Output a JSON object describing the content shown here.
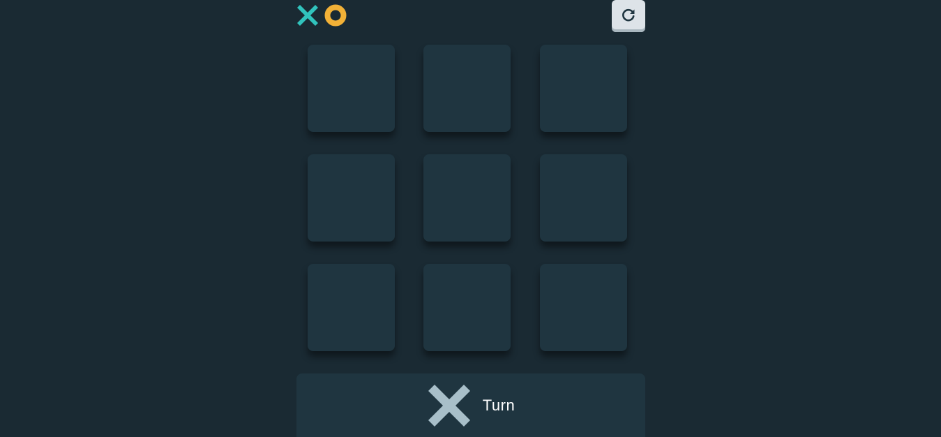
{
  "logo": {
    "x_icon": "x-mark-icon",
    "o_icon": "o-mark-icon",
    "x_color": "#31c3bd",
    "o_color": "#f2b137"
  },
  "toolbar": {
    "restart_icon": "restart-icon"
  },
  "board": {
    "cells": [
      "",
      "",
      "",
      "",
      "",
      "",
      "",
      "",
      ""
    ]
  },
  "turn": {
    "current_player_icon": "x-mark-icon",
    "icon_color": "#a8bfc9",
    "label": "Turn"
  },
  "colors": {
    "background": "#1a2a33",
    "cell": "#1f3540",
    "button": "#dde3e8"
  }
}
